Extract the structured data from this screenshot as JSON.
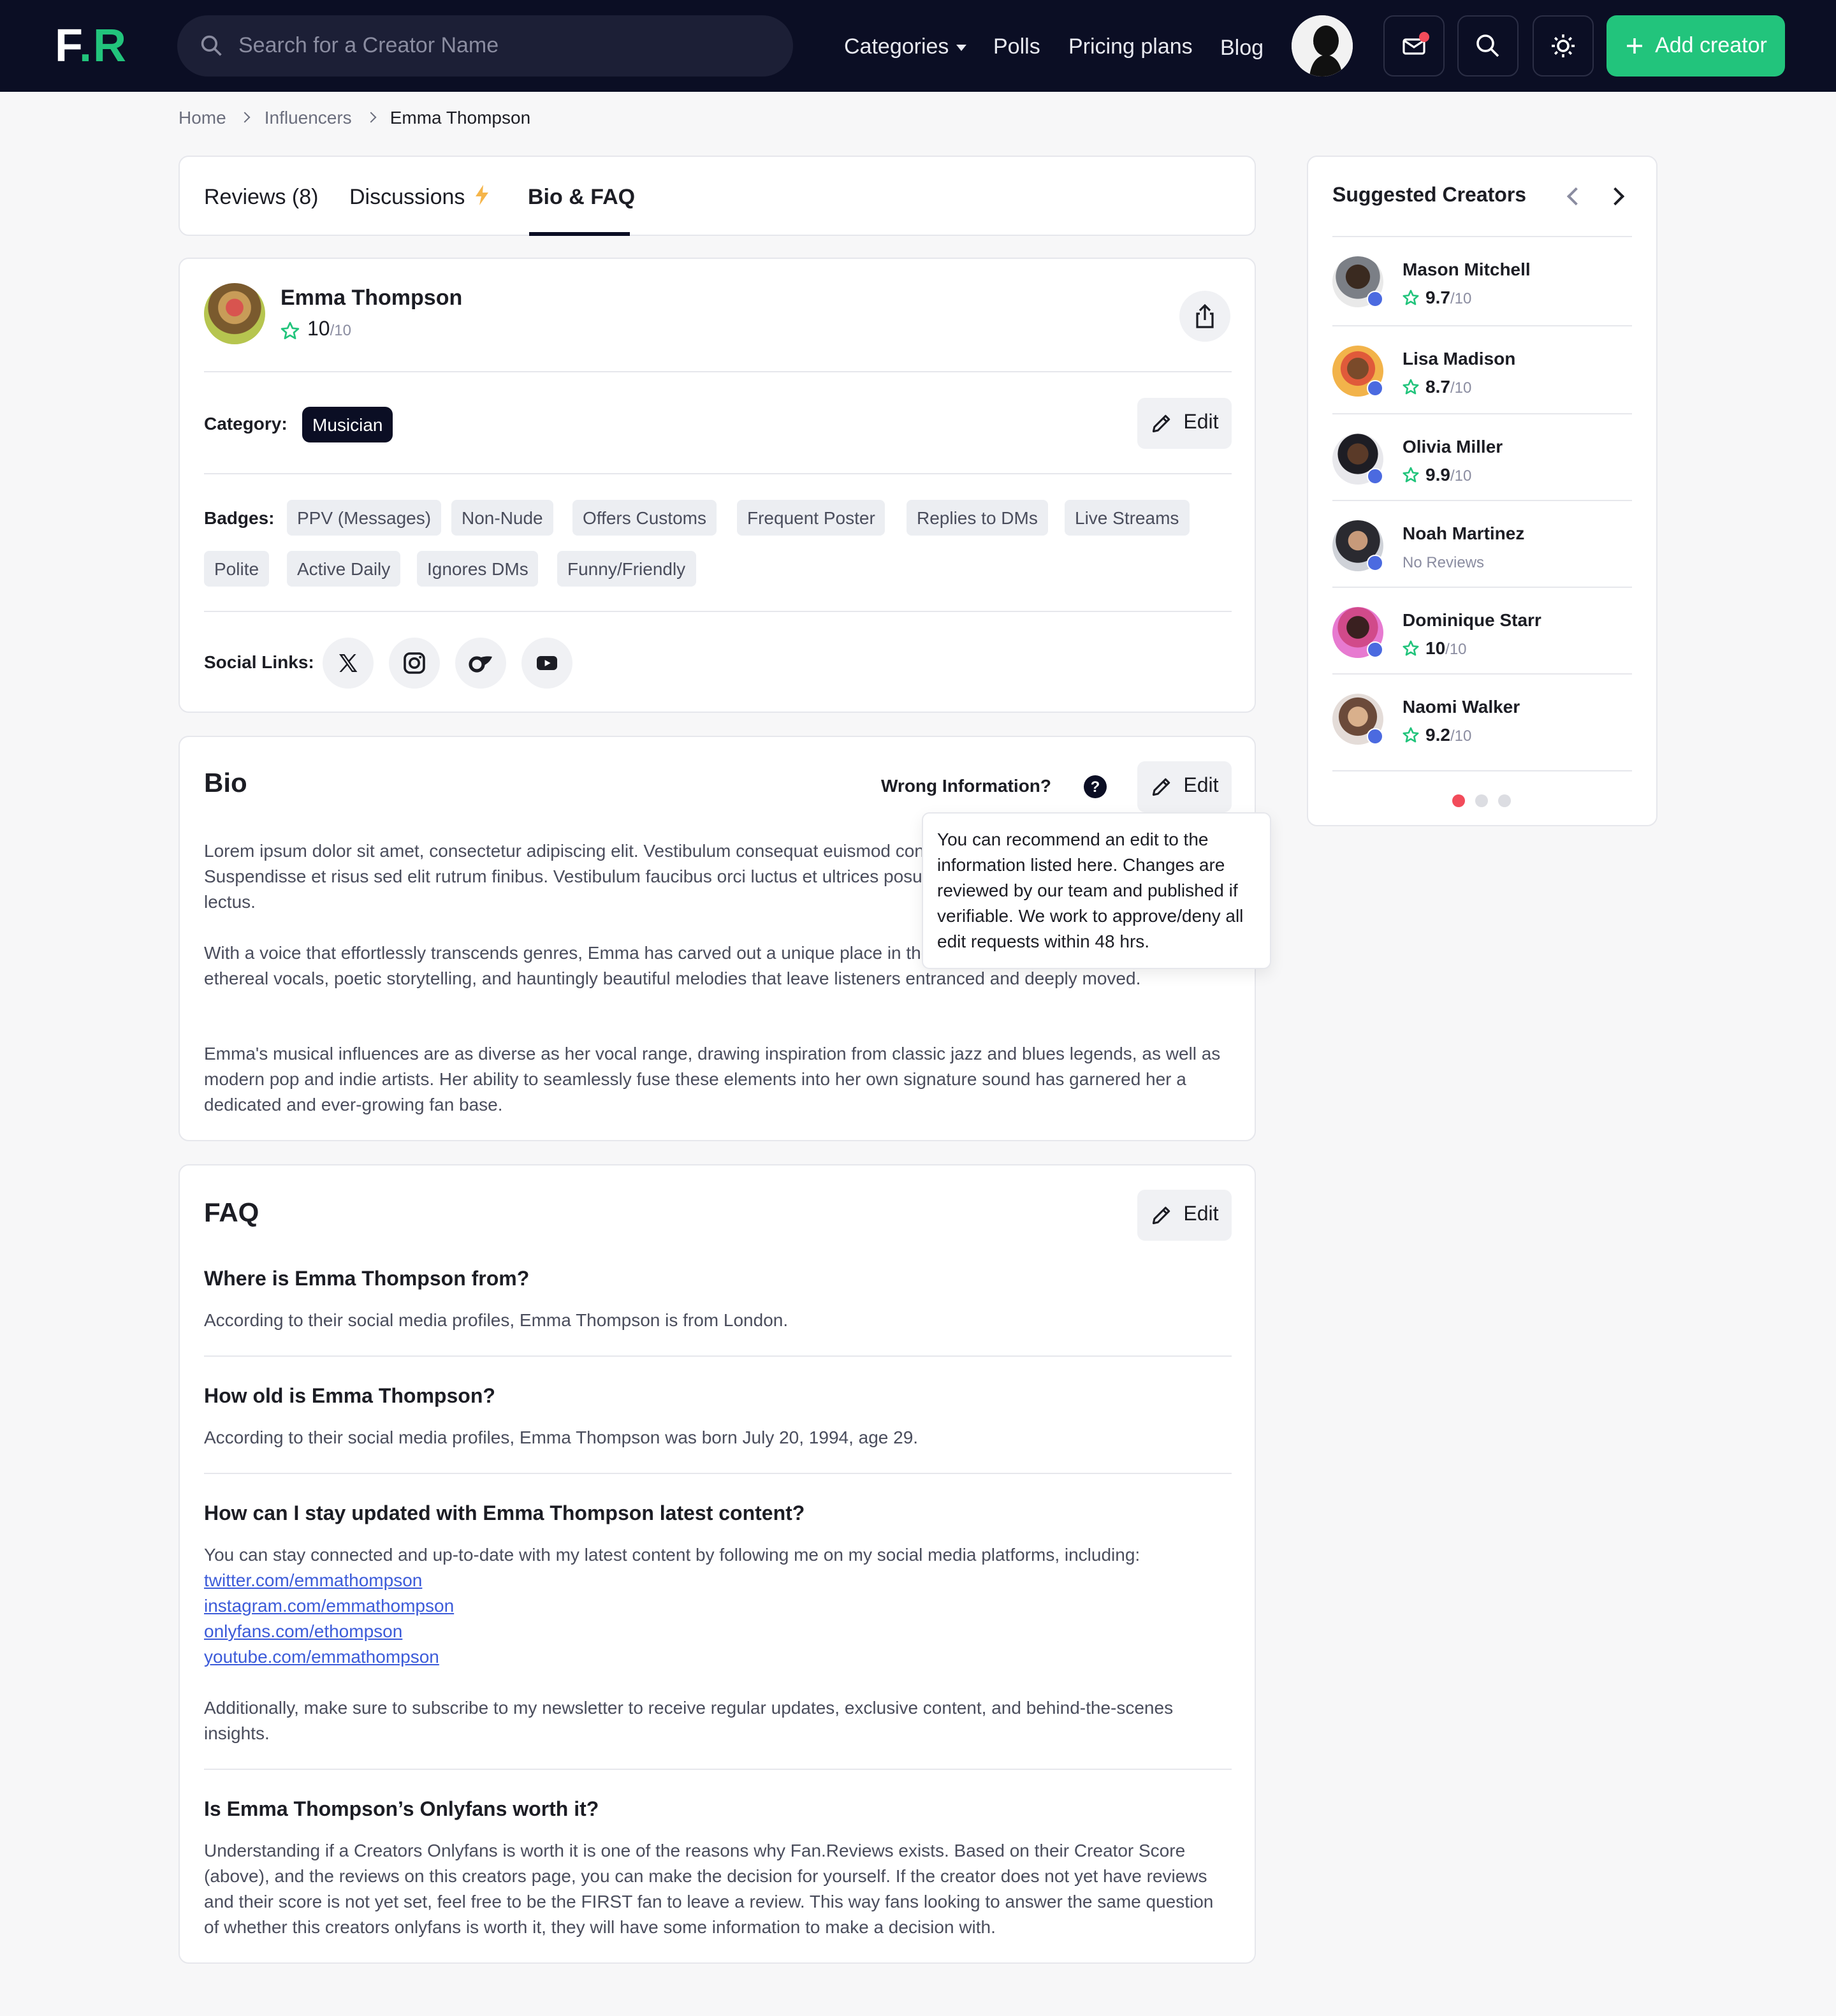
{
  "nav": {
    "logo_f": "F",
    "logo_dot": ".",
    "logo_r": "R",
    "search_placeholder": "Search for a Creator Name",
    "links": [
      "Categories",
      "Polls",
      "Pricing plans",
      "Blog"
    ],
    "add_creator": "Add creator",
    "accent": "#22c47c",
    "bg": "#0b0e24"
  },
  "breadcrumb": [
    "Home",
    "Influencers",
    "Emma Thompson"
  ],
  "tabs": [
    "Reviews (8)",
    "Discussions",
    "Bio & FAQ"
  ],
  "tabs_active": "Bio & FAQ",
  "profile": {
    "name": "Emma Thompson",
    "score": "10",
    "score_den": "/10",
    "category_label": "Category:",
    "category": "Musician",
    "edit_label": "Edit",
    "badges_label": "Badges:",
    "badges": [
      "PPV (Messages)",
      "Non-Nude",
      "Offers Customs",
      "Frequent Poster",
      "Replies to DMs",
      "Live Streams",
      "Polite",
      "Active Daily",
      "Ignores DMs",
      "Funny/Friendly"
    ],
    "social_label": "Social Links:",
    "social": [
      "x-icon",
      "instagram-icon",
      "onlyfans-icon",
      "youtube-icon"
    ]
  },
  "bio": {
    "title": "Bio",
    "wrong_info": "Wrong Information?",
    "question_mark": "?",
    "edit_label": "Edit",
    "paragraphs": [
      "Lorem ipsum dolor sit amet, consectetur adipiscing elit. Vestibulum consequat euismod consequat eu. Sed ut convallis metus. Suspendisse et risus sed elit rutrum finibus. Vestibulum faucibus orci luctus et ultrices posuere cubilia curae; Maecenas in justo lectus.",
      "With a voice that effortlessly transcends genres, Emma has carved out a unique place in the music industry with her blend of ethereal vocals, poetic storytelling, and hauntingly beautiful melodies that leave listeners entranced and deeply moved.",
      "Emma's musical influences are as diverse as her vocal range, drawing inspiration from classic jazz and blues legends, as well as modern pop and indie artists. Her ability to seamlessly fuse these elements into her own signature sound has garnered her a dedicated and ever-growing fan base."
    ],
    "tooltip": "You can recommend an edit to the information listed here. Changes are reviewed by our team and published if verifiable. We work to approve/deny all edit requests within 48 hrs."
  },
  "faq": {
    "title": "FAQ",
    "edit_label": "Edit",
    "items": [
      {
        "q": "Where is Emma Thompson from?",
        "a": "According to their social media profiles, Emma Thompson is from London."
      },
      {
        "q": "How old is Emma Thompson?",
        "a": "According to their social media profiles, Emma Thompson was born July 20, 1994, age 29."
      },
      {
        "q": "How can I stay updated with Emma Thompson latest content?",
        "a": "You can stay connected and up-to-date with my latest content by following me on my social media platforms, including:",
        "links": [
          "twitter.com/emmathompson",
          "instagram.com/emmathompson",
          "onlyfans.com/ethompson",
          "youtube.com/emmathompson"
        ],
        "a2": "Additionally, make sure to subscribe to my newsletter to receive regular updates, exclusive content, and behind-the-scenes insights."
      },
      {
        "q": "Is Emma Thompson’s Onlyfans worth it?",
        "a": "Understanding if a Creators Onlyfans is worth it is one of the reasons why Fan.Reviews exists. Based on their Creator Score (above), and the reviews on this creators page, you can make the decision for yourself. If the creator does not yet have reviews and their score is not yet set, feel free to be the FIRST fan to leave a review. This way fans looking to answer the same question of whether this creators onlyfans is worth it, they will have some information to make a decision with."
      }
    ]
  },
  "suggested": {
    "title": "Suggested Creators",
    "creators": [
      {
        "name": "Mason Mitchell",
        "score": "9.7",
        "den": "/10"
      },
      {
        "name": "Lisa Madison",
        "score": "8.7",
        "den": "/10"
      },
      {
        "name": "Olivia Miller",
        "score": "9.9",
        "den": "/10"
      },
      {
        "name": "Noah Martinez",
        "no_reviews": "No Reviews"
      },
      {
        "name": "Dominique Starr",
        "score": "10",
        "den": "/10"
      },
      {
        "name": "Naomi Walker",
        "score": "9.2",
        "den": "/10"
      }
    ],
    "page": 1,
    "pages": 3
  }
}
